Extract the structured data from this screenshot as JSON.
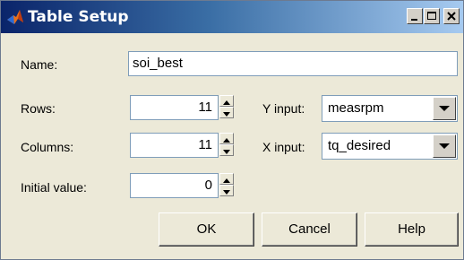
{
  "window": {
    "title": "Table Setup",
    "minimize_label": "_",
    "maximize_label": "□",
    "close_label": "×"
  },
  "form": {
    "name_label": "Name:",
    "name_value": "soi_best",
    "rows_label": "Rows:",
    "rows_value": "11",
    "columns_label": "Columns:",
    "columns_value": "11",
    "initial_label": "Initial value:",
    "initial_value": "0",
    "y_input_label": "Y input:",
    "y_input_value": "measrpm",
    "x_input_label": "X input:",
    "x_input_value": "tq_desired"
  },
  "buttons": {
    "ok": "OK",
    "cancel": "Cancel",
    "help": "Help"
  },
  "icons": {
    "app": "matlab-logo-icon",
    "spin_up": "triangle-up-icon",
    "spin_down": "triangle-down-icon",
    "dropdown": "triangle-down-icon"
  }
}
